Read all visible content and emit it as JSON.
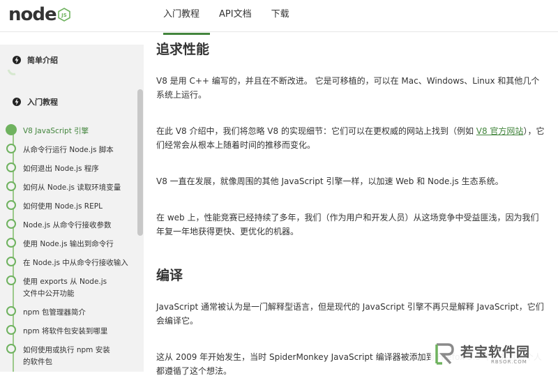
{
  "header": {
    "logo_text": "node",
    "logo_badge": "JS",
    "nav": [
      "入门教程",
      "API文档",
      "下载"
    ]
  },
  "sidebar": {
    "sections": [
      {
        "title": "简单介绍"
      },
      {
        "title": "入门教程"
      }
    ],
    "items": [
      {
        "label": "V8 JavaScript 引擎",
        "active": true
      },
      {
        "label": "从命令行运行 Node.js 脚本"
      },
      {
        "label": "如何退出 Node.js 程序"
      },
      {
        "label": "如何从 Node.js 读取环境变量"
      },
      {
        "label": "如何使用 Node.js REPL"
      },
      {
        "label": "Node.js 从命令行接收参数"
      },
      {
        "label": "使用 Node.js 输出到命令行"
      },
      {
        "label": "在 Node.js 中从命令行接收输入"
      },
      {
        "label": "使用 exports 从 Node.js 文件中公开功能"
      },
      {
        "label": "npm 包管理器简介"
      },
      {
        "label": "npm 将软件包安装到哪里"
      },
      {
        "label": "如何使用或执行 npm 安装的软件包"
      }
    ]
  },
  "content": {
    "h_perf": "追求性能",
    "p1": "V8 是用 C++ 编写的，并且在不断改进。 它是可移植的，可以在 Mac、Windows、Linux 和其他几个系统上运行。",
    "p2_before": "在此 V8 介绍中，我们将忽略 V8 的实现细节：它们可以在更权威的网站上找到（例如 ",
    "p2_link": "V8 官方网站",
    "p2_after": "），它们经常会从根本上随着时间的推移而变化。",
    "p3": "V8 一直在发展，就像周围的其他 JavaScript 引擎一样，以加速 Web 和 Node.js 生态系统。",
    "p4": "在 web 上，性能竞赛已经持续了多年，我们（作为用户和开发人员）从这场竞争中受益匪浅，因为我们年复一年地获得更快、更优化的机器。",
    "h_compile": "编译",
    "p5": "JavaScript 通常被认为是一门解释型语言，但是现代的 JavaScript 引擎不再只是解释 JavaScript，它们会编译它。",
    "p6": "这从 2009 年开始发生，当时 SpiderMonkey JavaScript 编译器被添加到 Firefox 3.5 中，并且每个人都遵循了这个想法。"
  },
  "watermark": {
    "text": "若宝软件园",
    "sub": "RBSOR.COM"
  },
  "colors": {
    "accent": "#43853d",
    "timeline": "#6fb25f"
  }
}
